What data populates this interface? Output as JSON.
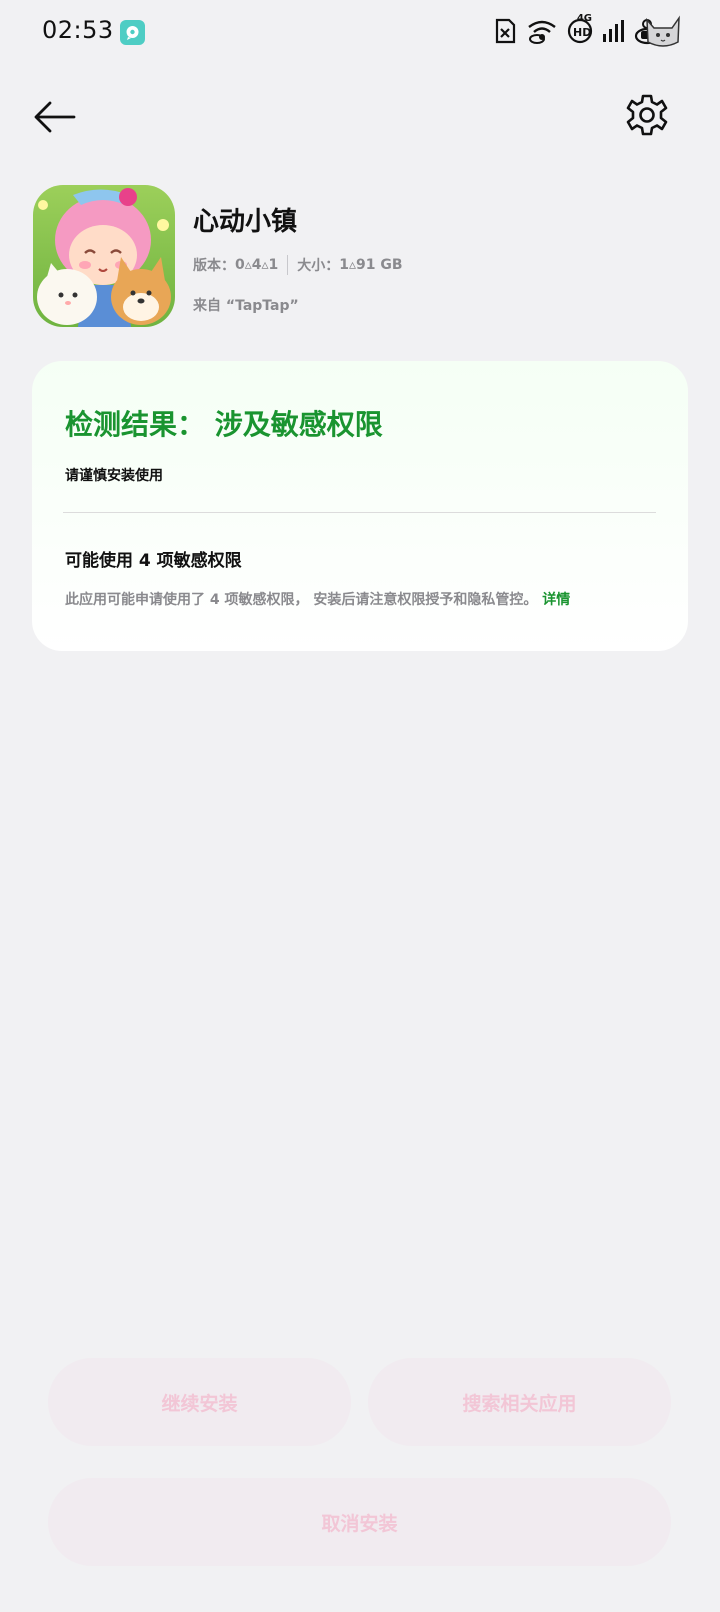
{
  "status_bar": {
    "time": "02:53",
    "network": "4G",
    "icons": [
      "chat-bubble-icon",
      "sim-x-icon",
      "wifi-icon",
      "hd-icon",
      "signal-icon",
      "battery-icon",
      "cat-avatar"
    ]
  },
  "nav": {
    "back_icon": "arrow-left-icon",
    "settings_icon": "gear-icon"
  },
  "app": {
    "name": "心动小镇",
    "version_label": "版本：",
    "version_value": "0▵4▵1",
    "size_label": "大小：",
    "size_value": "1▵91  GB",
    "source": "来自 “TapTap”"
  },
  "result": {
    "title": "检测结果：  涉及敏感权限",
    "subtitle": "请谨慎安装使用",
    "perm_title": "可能使用  4  项敏感权限",
    "perm_desc": "此应用可能申请使用了 4 项敏感权限， 安装后请注意权限授予和隐私管控。",
    "perm_link": "详情"
  },
  "colors": {
    "accent_green": "#1a9430",
    "button_text_pink": "#f2c6d6",
    "background": "#f1f1f3"
  },
  "buttons": {
    "continue": "继续安装",
    "search": "搜索相关应用",
    "cancel": "取消安装"
  }
}
